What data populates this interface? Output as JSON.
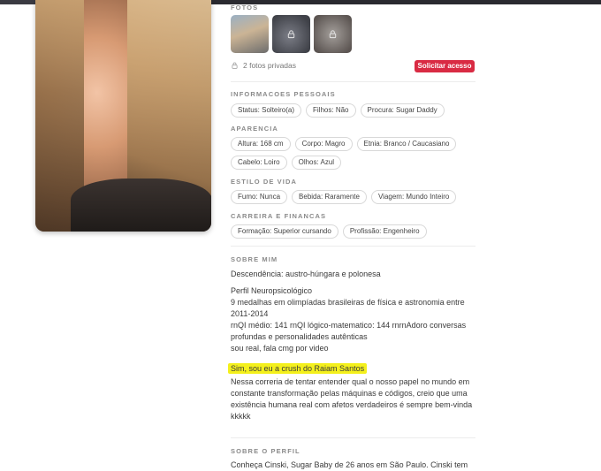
{
  "photos": {
    "section_label": "FOTOS",
    "private_text": "2 fotos privadas",
    "request_button": "Solicitar acesso"
  },
  "personal": {
    "section_label": "INFORMACOES PESSOAIS",
    "chips": [
      "Status: Solteiro(a)",
      "Filhos: Não",
      "Procura: Sugar Daddy"
    ]
  },
  "appearance": {
    "section_label": "APARENCIA",
    "row1": [
      "Altura: 168 cm",
      "Corpo: Magro",
      "Etnia: Branco / Caucasiano"
    ],
    "row2": [
      "Cabelo: Loiro",
      "Olhos: Azul"
    ]
  },
  "lifestyle": {
    "section_label": "ESTILO DE VIDA",
    "chips": [
      "Fumo: Nunca",
      "Bebida: Raramente",
      "Viagem: Mundo Inteiro"
    ]
  },
  "career": {
    "section_label": "CARREIRA E FINANCAS",
    "chips": [
      "Formação: Superior cursando",
      "Profissão: Engenheiro"
    ]
  },
  "about": {
    "section_label": "SOBRE MIM",
    "p1": "Descendência: austro-húngara e polonesa",
    "p2_l1": "Perfil Neuropsicológico",
    "p2_l2": "9 medalhas em olimpíadas brasileiras de física e astronomia entre",
    "p2_l3": "2011-2014",
    "p2_l4": "rnQI médio: 141 rnQI lógico-matematico: 144 rnrnAdoro conversas",
    "p2_l5": "profundas e personalidades autênticas",
    "p2_l6": "sou real, fala cmg por video",
    "highlight": "Sim, sou eu a crush do Raiam Santos",
    "p3_l1": "Nessa correria de tentar entender qual o nosso papel no mundo em",
    "p3_l2": "constante transformação pelas máquinas e códigos, creio que uma",
    "p3_l3": "existência humana real com afetos verdadeiros é sempre bem-vinda",
    "p3_l4": "kkkkk"
  },
  "profile": {
    "section_label": "SOBRE O PERFIL",
    "text": "Conheça Cinski, Sugar Baby de 26 anos em São Paulo. Cinski tem"
  }
}
